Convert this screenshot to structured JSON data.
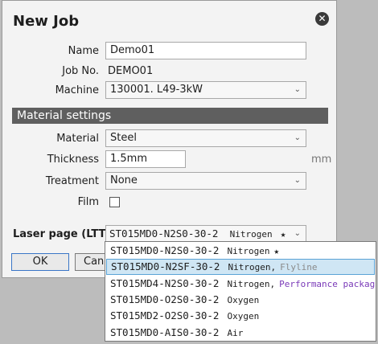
{
  "dialog": {
    "title": "New Job"
  },
  "form": {
    "name_label": "Name",
    "name_value": "Demo01",
    "jobno_label": "Job No.",
    "jobno_value": "DEMO01",
    "machine_label": "Machine",
    "machine_value": "130001. L49-3kW"
  },
  "material_settings": {
    "header": "Material settings",
    "material_label": "Material",
    "material_value": "Steel",
    "thickness_label": "Thickness",
    "thickness_value": "1.5mm",
    "thickness_unit": "mm",
    "treatment_label": "Treatment",
    "treatment_value": "None",
    "film_label": "Film",
    "film_checked": false
  },
  "laser_page": {
    "label": "Laser page (LTT)",
    "selected_code": "ST015MD0-N2S0-30-2",
    "selected_gas": "Nitrogen",
    "selected_star": "★"
  },
  "buttons": {
    "ok": "OK",
    "cancel": "Canc"
  },
  "dropdown": {
    "options": [
      {
        "code": "ST015MD0-N2S0-30-2",
        "gas": "Nitrogen",
        "note": "★",
        "note_color": "#1e1e1e"
      },
      {
        "code": "ST015MD0-N2SF-30-2",
        "gas": "Nitrogen,",
        "note": "Flyline",
        "note_color": "#8a8a8a"
      },
      {
        "code": "ST015MD4-N2S0-30-2",
        "gas": "Nitrogen,",
        "note": "Performance package",
        "note_color": "#7a3ab8"
      },
      {
        "code": "ST015MD0-O2S0-30-2",
        "gas": "Oxygen",
        "note": "",
        "note_color": "#1e1e1e"
      },
      {
        "code": "ST015MD2-O2S0-30-2",
        "gas": "Oxygen",
        "note": "",
        "note_color": "#1e1e1e"
      },
      {
        "code": "ST015MD0-AIS0-30-2",
        "gas": "Air",
        "note": "",
        "note_color": "#1e1e1e"
      }
    ],
    "selected_index": 1
  }
}
